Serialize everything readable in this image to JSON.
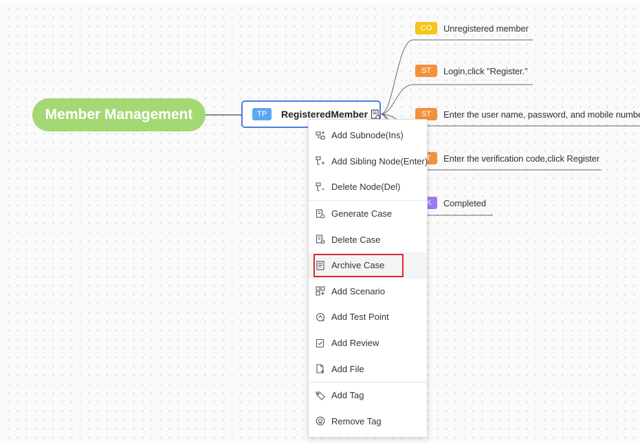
{
  "root_node": {
    "label": "Member Management"
  },
  "topic_node": {
    "tag": "TP",
    "label": "RegisteredMember"
  },
  "children": [
    {
      "tag": "CO",
      "color": "#f5c518",
      "label": "Unregistered member"
    },
    {
      "tag": "ST",
      "color": "#f5903b",
      "label": "Login,click \"Register.\""
    },
    {
      "tag": "ST",
      "color": "#f5903b",
      "label": "Enter the user name, password, and mobile number."
    },
    {
      "tag": "ST",
      "color": "#f5903b",
      "label": "Enter the verification code,click Register"
    },
    {
      "tag": "CK",
      "color": "#9a7bf0",
      "label": "Completed"
    }
  ],
  "context_menu": {
    "items": [
      {
        "label": "Add Subnode(Ins)",
        "icon": "add-subnode-icon"
      },
      {
        "label": "Add Sibling Node(Enter)",
        "icon": "add-sibling-icon"
      },
      {
        "label": "Delete Node(Del)",
        "icon": "delete-node-icon"
      },
      {
        "label": "Generate Case",
        "icon": "generate-case-icon"
      },
      {
        "label": "Delete Case",
        "icon": "delete-case-icon"
      },
      {
        "label": "Archive Case",
        "icon": "archive-case-icon",
        "highlighted": true
      },
      {
        "label": "Add Scenario",
        "icon": "add-scenario-icon"
      },
      {
        "label": "Add Test Point",
        "icon": "add-test-point-icon"
      },
      {
        "label": "Add Review",
        "icon": "add-review-icon"
      },
      {
        "label": "Add File",
        "icon": "add-file-icon"
      },
      {
        "label": "Add Tag",
        "icon": "tag-icon"
      },
      {
        "label": "Remove Tag",
        "icon": "remove-tag-icon"
      }
    ]
  },
  "colors": {
    "root": "#a4d874",
    "topic_border": "#4a7de2",
    "topic_tag": "#5aa9ef",
    "highlight": "#e0242b"
  }
}
